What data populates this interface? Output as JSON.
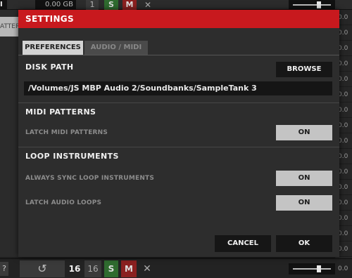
{
  "background": {
    "top": {
      "track_label": "I",
      "disk_usage": "0.00 GB",
      "channel_number": "1",
      "solo_label": "S",
      "mute_label": "M",
      "close_label": "✕"
    },
    "left_tab_label": "ATTERN",
    "right_values": [
      "0.0",
      "0.0",
      "0.0",
      "0.0",
      "0.0",
      "0.0",
      "0.0",
      "0.0",
      "0.0",
      "0.0",
      "0.0",
      "0.0",
      "0.0",
      "0.0",
      "0.0",
      "0.0"
    ],
    "bottom": {
      "left_cap": "?",
      "undo_icon": "↺",
      "current_number": "16",
      "second_number": "16",
      "solo_label": "S",
      "mute_label": "M",
      "close_label": "✕",
      "value": "0.0"
    }
  },
  "modal": {
    "title": "SETTINGS",
    "tabs": [
      {
        "label": "PREFERENCES",
        "active": true
      },
      {
        "label": "AUDIO / MIDI",
        "active": false
      }
    ],
    "disk_path": {
      "title": "DISK PATH",
      "browse_label": "BROWSE",
      "value": "/Volumes/JS MBP Audio 2/Soundbanks/SampleTank 3"
    },
    "midi_patterns": {
      "title": "MIDI PATTERNS",
      "rows": [
        {
          "label": "LATCH MIDI PATTERNS",
          "value": "ON"
        }
      ]
    },
    "loop_instruments": {
      "title": "LOOP INSTRUMENTS",
      "rows": [
        {
          "label": "ALWAYS SYNC LOOP INSTRUMENTS",
          "value": "ON"
        },
        {
          "label": "LATCH AUDIO LOOPS",
          "value": "ON"
        }
      ]
    },
    "footer": {
      "cancel_label": "CANCEL",
      "ok_label": "OK"
    }
  },
  "colors": {
    "header_red": "#c8191e",
    "active_tab": "#d3d3d3",
    "toggle_on": "#c4c4c4",
    "solo_green": "#2f6b2f",
    "mute_red": "#8a2020"
  }
}
